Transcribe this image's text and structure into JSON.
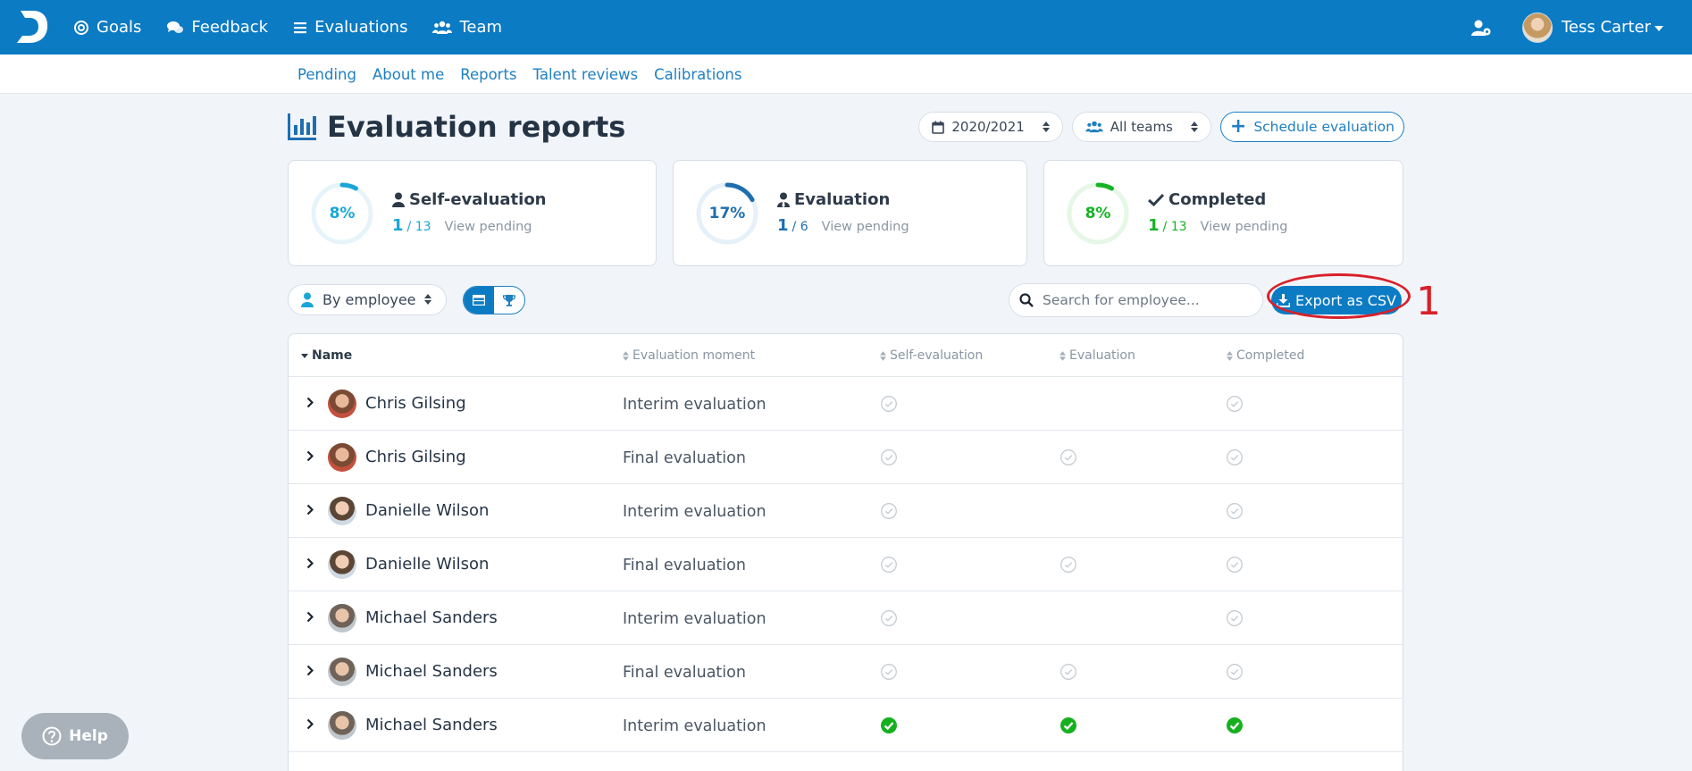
{
  "topbar": {
    "logo_icon": "deepdive-logo-icon",
    "nav": [
      {
        "label": "Goals",
        "icon": "target-icon"
      },
      {
        "label": "Feedback",
        "icon": "chat-bubbles-icon"
      },
      {
        "label": "Evaluations",
        "icon": "list-icon"
      },
      {
        "label": "Team",
        "icon": "users-icon"
      }
    ],
    "user_name": "Tess Carter",
    "brand_color": "#0b7bc4"
  },
  "subnav": [
    "Pending",
    "About me",
    "Reports",
    "Talent reviews",
    "Calibrations"
  ],
  "header": {
    "title": "Evaluation reports",
    "year_select": "2020/2021",
    "team_select": "All teams",
    "schedule_label": "Schedule evaluation"
  },
  "cards": [
    {
      "title": "Self-evaluation",
      "percent": "8%",
      "progress": 0.08,
      "num": "1",
      "den": "/ 13",
      "link": "View pending",
      "color": "#1aa6d6",
      "icon": "user-icon"
    },
    {
      "title": "Evaluation",
      "percent": "17%",
      "progress": 0.17,
      "num": "1",
      "den": "/ 6",
      "link": "View pending",
      "color": "#1f6fb0",
      "icon": "user-tie-icon"
    },
    {
      "title": "Completed",
      "percent": "8%",
      "progress": 0.08,
      "num": "1",
      "den": "/ 13",
      "link": "View pending",
      "color": "#17b324",
      "icon": "check-icon"
    }
  ],
  "toolbar": {
    "group_select": "By employee",
    "search_placeholder": "Search for employee...",
    "export_label": "Export as CSV",
    "annotation_number": "1"
  },
  "table": {
    "columns": [
      "Name",
      "Evaluation moment",
      "Self-evaluation",
      "Evaluation",
      "Completed"
    ],
    "rows": [
      {
        "name": "Chris Gilsing",
        "moment": "Interim evaluation",
        "self": "pending",
        "eval": "none",
        "done": "pending",
        "avatar": "a"
      },
      {
        "name": "Chris Gilsing",
        "moment": "Final evaluation",
        "self": "pending",
        "eval": "pending",
        "done": "pending",
        "avatar": "a"
      },
      {
        "name": "Danielle Wilson",
        "moment": "Interim evaluation",
        "self": "pending",
        "eval": "none",
        "done": "pending",
        "avatar": "b"
      },
      {
        "name": "Danielle Wilson",
        "moment": "Final evaluation",
        "self": "pending",
        "eval": "pending",
        "done": "pending",
        "avatar": "b"
      },
      {
        "name": "Michael Sanders",
        "moment": "Interim evaluation",
        "self": "pending",
        "eval": "none",
        "done": "pending",
        "avatar": "c"
      },
      {
        "name": "Michael Sanders",
        "moment": "Final evaluation",
        "self": "pending",
        "eval": "pending",
        "done": "pending",
        "avatar": "c"
      },
      {
        "name": "Michael Sanders",
        "moment": "Interim evaluation",
        "self": "done",
        "eval": "done",
        "done": "done",
        "avatar": "c"
      }
    ]
  },
  "help_label": "Help"
}
